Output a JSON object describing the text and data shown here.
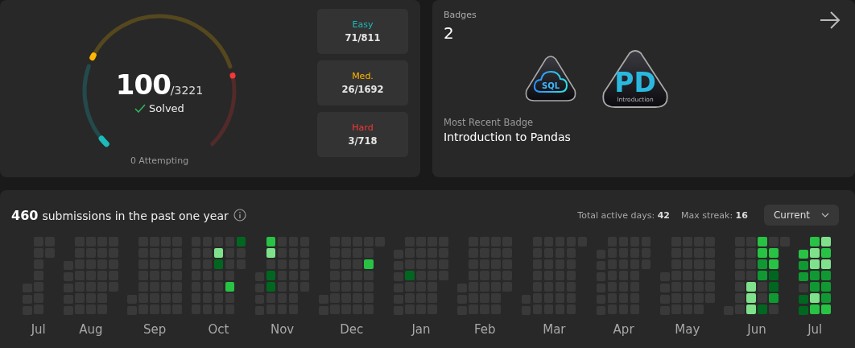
{
  "solved": {
    "count": "100",
    "total": "/3221",
    "label": "Solved",
    "attempting": "0 Attempting"
  },
  "difficulties": [
    {
      "kind": "easy",
      "label": "Easy",
      "value": "71/811"
    },
    {
      "kind": "medium",
      "label": "Med.",
      "value": "26/1692"
    },
    {
      "kind": "hard",
      "label": "Hard",
      "value": "3/718"
    }
  ],
  "badges": {
    "title": "Badges",
    "count": "2",
    "items": [
      {
        "kind": "sql",
        "text": "SQL"
      },
      {
        "kind": "pd",
        "text": "PD",
        "caption": "Introduction"
      }
    ],
    "recent_label": "Most Recent Badge",
    "recent_name": "Introduction to Pandas"
  },
  "submissions": {
    "count": "460",
    "text": "submissions in the past one year",
    "active_days_label": "Total active days:",
    "active_days": "42",
    "max_streak_label": "Max streak:",
    "max_streak": "16",
    "dropdown": "Current"
  },
  "heatmap": {
    "months": [
      {
        "label": "Jul",
        "weeks": [
          [
            {
              "color": "#393939"
            },
            {
              "color": "#393939"
            },
            {
              "color": "#393939"
            }
          ],
          [
            {
              "color": "#393939"
            },
            {
              "color": "#393939"
            },
            {
              "color": "#393939"
            },
            {
              "color": "#393939"
            },
            {
              "color": "#393939"
            },
            {
              "color": "#393939"
            },
            {
              "color": "#393939"
            }
          ],
          [
            {
              "color": "#393939"
            },
            {
              "color": "#393939"
            }
          ]
        ]
      },
      {
        "label": "Aug",
        "weeks": [
          [
            {
              "color": "#393939"
            },
            {
              "color": "#393939"
            },
            {
              "color": "#393939"
            },
            {
              "color": "#393939"
            },
            {
              "color": "#393939"
            }
          ],
          [
            {
              "color": "#393939"
            },
            {
              "color": "#393939"
            },
            {
              "color": "#393939"
            },
            {
              "color": "#393939"
            },
            {
              "color": "#393939"
            },
            {
              "color": "#393939"
            },
            {
              "color": "#393939"
            }
          ],
          [
            {
              "color": "#393939"
            },
            {
              "color": "#393939"
            },
            {
              "color": "#393939"
            },
            {
              "color": "#393939"
            },
            {
              "color": "#393939"
            },
            {
              "color": "#393939"
            },
            {
              "color": "#393939"
            }
          ],
          [
            {
              "color": "#393939"
            },
            {
              "color": "#393939"
            },
            {
              "color": "#393939"
            },
            {
              "color": "#393939"
            },
            {
              "color": "#393939"
            },
            {
              "color": "#393939"
            },
            {
              "color": "#393939"
            }
          ],
          [
            {
              "color": "#393939"
            },
            {
              "color": "#393939"
            },
            {
              "color": "#393939"
            },
            {
              "color": "#393939"
            },
            {
              "color": "#393939"
            }
          ]
        ]
      },
      {
        "label": "Sep",
        "weeks": [
          [
            {
              "color": "#393939"
            },
            {
              "color": "#393939"
            }
          ],
          [
            {
              "color": "#393939"
            },
            {
              "color": "#393939"
            },
            {
              "color": "#393939"
            },
            {
              "color": "#393939"
            },
            {
              "color": "#393939"
            },
            {
              "color": "#393939"
            },
            {
              "color": "#393939"
            }
          ],
          [
            {
              "color": "#393939"
            },
            {
              "color": "#393939"
            },
            {
              "color": "#393939"
            },
            {
              "color": "#393939"
            },
            {
              "color": "#393939"
            },
            {
              "color": "#393939"
            },
            {
              "color": "#393939"
            }
          ],
          [
            {
              "color": "#393939"
            },
            {
              "color": "#393939"
            },
            {
              "color": "#393939"
            },
            {
              "color": "#393939"
            },
            {
              "color": "#393939"
            },
            {
              "color": "#393939"
            },
            {
              "color": "#393939"
            }
          ],
          [
            {
              "color": "#393939"
            },
            {
              "color": "#393939"
            },
            {
              "color": "#393939"
            },
            {
              "color": "#393939"
            },
            {
              "color": "#393939"
            },
            {
              "color": "#393939"
            },
            {
              "color": "#393939"
            }
          ]
        ]
      },
      {
        "label": "Oct",
        "weeks": [
          [
            {
              "color": "#393939"
            },
            {
              "color": "#393939"
            },
            {
              "color": "#393939"
            },
            {
              "color": "#393939"
            },
            {
              "color": "#393939"
            },
            {
              "color": "#393939"
            },
            {
              "color": "#393939"
            }
          ],
          [
            {
              "color": "#393939"
            },
            {
              "color": "#393939"
            },
            {
              "color": "#393939"
            },
            {
              "color": "#393939"
            },
            {
              "color": "#393939"
            },
            {
              "color": "#393939"
            },
            {
              "color": "#393939"
            }
          ],
          [
            {
              "color": "#393939"
            },
            {
              "color": "#7fe18b"
            },
            {
              "color": "#016620"
            },
            {
              "color": "#393939"
            },
            {
              "color": "#393939"
            },
            {
              "color": "#393939"
            },
            {
              "color": "#393939"
            }
          ],
          [
            {
              "color": "#393939"
            },
            {
              "color": "#393939"
            },
            {
              "color": "#393939"
            },
            {
              "color": "#393939"
            },
            {
              "color": "#28c244"
            },
            {
              "color": "#393939"
            },
            {
              "color": "#393939"
            }
          ],
          [
            {
              "color": "#016620"
            },
            {
              "color": "#393939"
            },
            {
              "color": "#393939"
            }
          ]
        ]
      },
      {
        "label": "Nov",
        "weeks": [
          [
            {
              "color": "#393939"
            },
            {
              "color": "#393939"
            },
            {
              "color": "#393939"
            },
            {
              "color": "#393939"
            }
          ],
          [
            {
              "color": "#28c244"
            },
            {
              "color": "#7fe18b"
            },
            {
              "color": "#393939"
            },
            {
              "color": "#016620"
            },
            {
              "color": "#016620"
            },
            {
              "color": "#393939"
            },
            {
              "color": "#393939"
            }
          ],
          [
            {
              "color": "#393939"
            },
            {
              "color": "#393939"
            },
            {
              "color": "#393939"
            },
            {
              "color": "#393939"
            },
            {
              "color": "#393939"
            },
            {
              "color": "#393939"
            },
            {
              "color": "#393939"
            }
          ],
          [
            {
              "color": "#393939"
            },
            {
              "color": "#393939"
            },
            {
              "color": "#393939"
            },
            {
              "color": "#393939"
            },
            {
              "color": "#393939"
            },
            {
              "color": "#393939"
            },
            {
              "color": "#393939"
            }
          ],
          [
            {
              "color": "#393939"
            },
            {
              "color": "#393939"
            },
            {
              "color": "#393939"
            },
            {
              "color": "#393939"
            },
            {
              "color": "#393939"
            }
          ]
        ]
      },
      {
        "label": "Dec",
        "weeks": [
          [
            {
              "color": "#393939"
            },
            {
              "color": "#393939"
            }
          ],
          [
            {
              "color": "#393939"
            },
            {
              "color": "#393939"
            },
            {
              "color": "#393939"
            },
            {
              "color": "#393939"
            },
            {
              "color": "#393939"
            },
            {
              "color": "#393939"
            },
            {
              "color": "#393939"
            }
          ],
          [
            {
              "color": "#393939"
            },
            {
              "color": "#393939"
            },
            {
              "color": "#393939"
            },
            {
              "color": "#393939"
            },
            {
              "color": "#393939"
            },
            {
              "color": "#393939"
            },
            {
              "color": "#393939"
            }
          ],
          [
            {
              "color": "#393939"
            },
            {
              "color": "#393939"
            },
            {
              "color": "#393939"
            },
            {
              "color": "#393939"
            },
            {
              "color": "#393939"
            },
            {
              "color": "#393939"
            },
            {
              "color": "#393939"
            }
          ],
          [
            {
              "color": "#393939"
            },
            {
              "color": "#393939"
            },
            {
              "color": "#28c244"
            },
            {
              "color": "#393939"
            },
            {
              "color": "#393939"
            },
            {
              "color": "#393939"
            },
            {
              "color": "#393939"
            }
          ],
          [
            {
              "color": "#393939"
            }
          ]
        ]
      },
      {
        "label": "Jan",
        "weeks": [
          [
            {
              "color": "#393939"
            },
            {
              "color": "#393939"
            },
            {
              "color": "#393939"
            },
            {
              "color": "#393939"
            },
            {
              "color": "#393939"
            },
            {
              "color": "#393939"
            }
          ],
          [
            {
              "color": "#393939"
            },
            {
              "color": "#393939"
            },
            {
              "color": "#393939"
            },
            {
              "color": "#016620"
            },
            {
              "color": "#393939"
            },
            {
              "color": "#393939"
            },
            {
              "color": "#393939"
            }
          ],
          [
            {
              "color": "#393939"
            },
            {
              "color": "#393939"
            },
            {
              "color": "#393939"
            },
            {
              "color": "#393939"
            },
            {
              "color": "#393939"
            },
            {
              "color": "#393939"
            },
            {
              "color": "#393939"
            }
          ],
          [
            {
              "color": "#393939"
            },
            {
              "color": "#393939"
            },
            {
              "color": "#393939"
            },
            {
              "color": "#393939"
            },
            {
              "color": "#393939"
            },
            {
              "color": "#393939"
            },
            {
              "color": "#393939"
            }
          ],
          [
            {
              "color": "#393939"
            },
            {
              "color": "#393939"
            },
            {
              "color": "#393939"
            },
            {
              "color": "#393939"
            }
          ]
        ]
      },
      {
        "label": "Feb",
        "weeks": [
          [
            {
              "color": "#393939"
            },
            {
              "color": "#393939"
            },
            {
              "color": "#393939"
            }
          ],
          [
            {
              "color": "#393939"
            },
            {
              "color": "#393939"
            },
            {
              "color": "#393939"
            },
            {
              "color": "#393939"
            },
            {
              "color": "#393939"
            },
            {
              "color": "#393939"
            },
            {
              "color": "#393939"
            }
          ],
          [
            {
              "color": "#393939"
            },
            {
              "color": "#393939"
            },
            {
              "color": "#393939"
            },
            {
              "color": "#393939"
            },
            {
              "color": "#393939"
            },
            {
              "color": "#393939"
            },
            {
              "color": "#393939"
            }
          ],
          [
            {
              "color": "#393939"
            },
            {
              "color": "#393939"
            },
            {
              "color": "#393939"
            },
            {
              "color": "#393939"
            },
            {
              "color": "#393939"
            },
            {
              "color": "#393939"
            },
            {
              "color": "#393939"
            }
          ],
          [
            {
              "color": "#393939"
            },
            {
              "color": "#393939"
            },
            {
              "color": "#393939"
            },
            {
              "color": "#393939"
            },
            {
              "color": "#393939"
            }
          ]
        ]
      },
      {
        "label": "Mar",
        "weeks": [
          [
            {
              "color": "#393939"
            },
            {
              "color": "#393939"
            }
          ],
          [
            {
              "color": "#393939"
            },
            {
              "color": "#393939"
            },
            {
              "color": "#393939"
            },
            {
              "color": "#393939"
            },
            {
              "color": "#393939"
            },
            {
              "color": "#393939"
            },
            {
              "color": "#393939"
            }
          ],
          [
            {
              "color": "#393939"
            },
            {
              "color": "#393939"
            },
            {
              "color": "#393939"
            },
            {
              "color": "#393939"
            },
            {
              "color": "#393939"
            },
            {
              "color": "#393939"
            },
            {
              "color": "#393939"
            }
          ],
          [
            {
              "color": "#393939"
            },
            {
              "color": "#393939"
            },
            {
              "color": "#393939"
            },
            {
              "color": "#393939"
            },
            {
              "color": "#393939"
            },
            {
              "color": "#393939"
            },
            {
              "color": "#393939"
            }
          ],
          [
            {
              "color": "#393939"
            },
            {
              "color": "#393939"
            },
            {
              "color": "#393939"
            },
            {
              "color": "#393939"
            },
            {
              "color": "#393939"
            },
            {
              "color": "#393939"
            },
            {
              "color": "#393939"
            }
          ],
          [
            {
              "color": "#393939"
            }
          ]
        ]
      },
      {
        "label": "Apr",
        "weeks": [
          [
            {
              "color": "#393939"
            },
            {
              "color": "#393939"
            },
            {
              "color": "#393939"
            },
            {
              "color": "#393939"
            },
            {
              "color": "#393939"
            },
            {
              "color": "#393939"
            }
          ],
          [
            {
              "color": "#393939"
            },
            {
              "color": "#393939"
            },
            {
              "color": "#393939"
            },
            {
              "color": "#393939"
            },
            {
              "color": "#393939"
            },
            {
              "color": "#393939"
            },
            {
              "color": "#393939"
            }
          ],
          [
            {
              "color": "#393939"
            },
            {
              "color": "#393939"
            },
            {
              "color": "#393939"
            },
            {
              "color": "#393939"
            },
            {
              "color": "#393939"
            },
            {
              "color": "#393939"
            },
            {
              "color": "#393939"
            }
          ],
          [
            {
              "color": "#393939"
            },
            {
              "color": "#393939"
            },
            {
              "color": "#393939"
            },
            {
              "color": "#393939"
            },
            {
              "color": "#393939"
            },
            {
              "color": "#393939"
            },
            {
              "color": "#393939"
            }
          ],
          [
            {
              "color": "#393939"
            },
            {
              "color": "#393939"
            },
            {
              "color": "#393939"
            }
          ]
        ]
      },
      {
        "label": "May",
        "weeks": [
          [
            {
              "color": "#393939"
            },
            {
              "color": "#393939"
            },
            {
              "color": "#393939"
            },
            {
              "color": "#393939"
            }
          ],
          [
            {
              "color": "#393939"
            },
            {
              "color": "#393939"
            },
            {
              "color": "#393939"
            },
            {
              "color": "#393939"
            },
            {
              "color": "#393939"
            },
            {
              "color": "#393939"
            },
            {
              "color": "#393939"
            }
          ],
          [
            {
              "color": "#393939"
            },
            {
              "color": "#393939"
            },
            {
              "color": "#393939"
            },
            {
              "color": "#393939"
            },
            {
              "color": "#393939"
            },
            {
              "color": "#393939"
            },
            {
              "color": "#393939"
            }
          ],
          [
            {
              "color": "#393939"
            },
            {
              "color": "#393939"
            },
            {
              "color": "#393939"
            },
            {
              "color": "#393939"
            },
            {
              "color": "#393939"
            },
            {
              "color": "#393939"
            },
            {
              "color": "#393939"
            }
          ],
          [
            {
              "color": "#393939"
            },
            {
              "color": "#393939"
            },
            {
              "color": "#393939"
            },
            {
              "color": "#393939"
            },
            {
              "color": "#393939"
            },
            {
              "color": "#393939"
            }
          ]
        ]
      },
      {
        "label": "Jun",
        "weeks": [
          [
            {
              "color": "#393939"
            }
          ],
          [
            {
              "color": "#393939"
            },
            {
              "color": "#393939"
            },
            {
              "color": "#393939"
            },
            {
              "color": "#393939"
            },
            {
              "color": "#393939"
            },
            {
              "color": "#393939"
            },
            {
              "color": "#393939"
            }
          ],
          [
            {
              "color": "#393939"
            },
            {
              "color": "#393939"
            },
            {
              "color": "#393939"
            },
            {
              "color": "#393939"
            },
            {
              "color": "#7fe18b"
            },
            {
              "color": "#7fe18b"
            },
            {
              "color": "#7fe18b"
            }
          ],
          [
            {
              "color": "#28c244"
            },
            {
              "color": "#28c244"
            },
            {
              "color": "#109932"
            },
            {
              "color": "#109932"
            },
            {
              "color": "#393939"
            },
            {
              "color": "#393939"
            },
            {
              "color": "#016620"
            }
          ],
          [
            {
              "color": "#393939"
            },
            {
              "color": "#28c244"
            },
            {
              "color": "#28c244"
            },
            {
              "color": "#016620"
            },
            {
              "color": "#016620"
            },
            {
              "color": "#109932"
            },
            {
              "color": "#393939"
            }
          ],
          [
            {
              "color": "#393939"
            }
          ]
        ]
      },
      {
        "label": "Jul",
        "weeks": [
          [
            {
              "color": "#28c244"
            },
            {
              "color": "#109932"
            },
            {
              "color": "#109932"
            },
            {
              "color": "#393939"
            },
            {
              "color": "#016620"
            },
            {
              "color": "#016620"
            }
          ],
          [
            {
              "color": "#28c244"
            },
            {
              "color": "#7fe18b"
            },
            {
              "color": "#7fe18b"
            },
            {
              "color": "#109932"
            },
            {
              "color": "#109932"
            },
            {
              "color": "#7fe18b"
            },
            {
              "color": "#28c244"
            }
          ],
          [
            {
              "color": "#7fe18b"
            },
            {
              "color": "#28c244"
            },
            {
              "color": "#7fe18b"
            },
            {
              "color": "#109932"
            },
            {
              "color": "#109932"
            },
            {
              "color": "#109932"
            },
            {
              "color": "#28c244"
            }
          ]
        ]
      }
    ]
  }
}
